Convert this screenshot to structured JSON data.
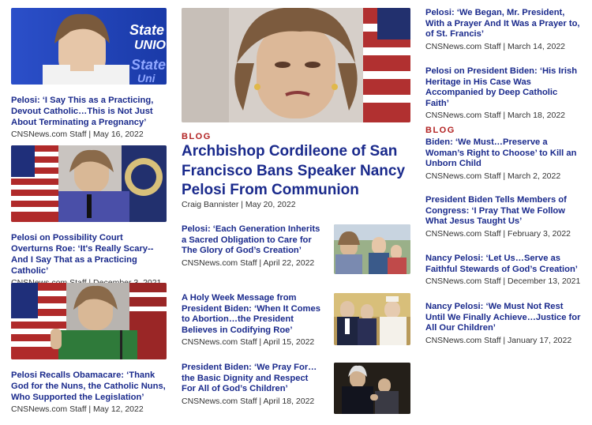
{
  "hero": {
    "kicker": "BLOG",
    "title": "Archbishop Cordileone of San Francisco Bans Speaker Nancy Pelosi From Communion",
    "meta": "Craig Bannister | May 20, 2022",
    "image": "pelosi-portrait-photo"
  },
  "left_stories": [
    {
      "title": "Pelosi: ‘I Say This as a Practicing, Devout Catholic…This is Not Just About Terminating a Pregnancy’",
      "meta": "CNSNews.com Staff | May 16, 2022",
      "image": "pelosi-state-of-union-photo",
      "overlay_text": "State\nUNIO\nState\nUni"
    },
    {
      "title": "Pelosi on Possibility Court Overturns Roe: ‘It's Really Scary--And I Say That as a Practicing Catholic’",
      "meta": "CNSNews.com Staff | December 3, 2021",
      "image": "pelosi-podium-flags-photo"
    },
    {
      "title": "Pelosi Recalls Obamacare: ‘Thank God for the Nuns, the Catholic Nuns, Who Supported the Legislation’",
      "meta": "CNSNews.com Staff | May 12, 2022",
      "image": "pelosi-green-jacket-photo"
    }
  ],
  "mid_stories": [
    {
      "title": "Pelosi: ‘Each Generation Inherits a Sacred Obligation to Care for The Glory of God’s Creation’",
      "meta": "CNSNews.com Staff | April 22, 2022",
      "image": "pelosi-with-children-photo"
    },
    {
      "title": "A Holy Week Message from President Biden: ‘When It Comes to Abortion…the President Believes in Codifying Roe’",
      "meta": "CNSNews.com Staff | April 15, 2022",
      "image": "biden-with-pope-photo"
    },
    {
      "title": "President Biden: ‘We Pray For…the Basic Dignity and Respect For All of God’s Children’",
      "meta": "CNSNews.com Staff | April 18, 2022",
      "image": "biden-dark-photo"
    }
  ],
  "right_stories": [
    {
      "kicker": "",
      "title": "Pelosi: ‘We Began, Mr. President, With a Prayer And It Was a Prayer to, of St. Francis’",
      "meta": "CNSNews.com Staff | March 14, 2022"
    },
    {
      "kicker": "",
      "title": "Pelosi on President Biden: ‘His Irish Heritage in His Case Was Accompanied by Deep Catholic Faith’",
      "meta": "CNSNews.com Staff | March 18, 2022"
    },
    {
      "kicker": "BLOG",
      "title": "Biden: ‘We Must…Preserve a Woman’s Right to Choose’ to Kill an Unborn Child",
      "meta": "CNSNews.com Staff | March 2, 2022"
    },
    {
      "kicker": "",
      "title": "President Biden Tells Members of Congress: ‘I Pray That We Follow What Jesus Taught Us’",
      "meta": "CNSNews.com Staff | February 3, 2022"
    },
    {
      "kicker": "",
      "title": "Nancy Pelosi: ‘Let Us…Serve as Faithful Stewards of God’s Creation’",
      "meta": "CNSNews.com Staff | December 13, 2021"
    },
    {
      "kicker": "",
      "title": "Nancy Pelosi: ‘We Must Not Rest Until We Finally Achieve…Justice for All Our Children’",
      "meta": "CNSNews.com Staff | January 17, 2022"
    }
  ],
  "colors": {
    "link": "#1a2a8c",
    "kicker": "#b22222",
    "meta": "#333333"
  }
}
